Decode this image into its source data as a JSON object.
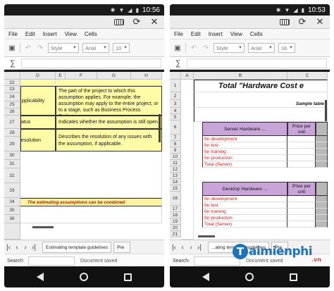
{
  "status_bar": {
    "time": "10:56",
    "time_right": "10:53"
  },
  "menu": [
    "File",
    "Edit",
    "Insert",
    "View",
    "Cells"
  ],
  "toolbar": {
    "style": "Style",
    "font": "Arial",
    "size_left": "10",
    "size_right": "16"
  },
  "formula_symbol": "∑",
  "left": {
    "columns": [
      "D",
      "E",
      "F",
      "G",
      "H"
    ],
    "rows": [
      {
        "num": "22",
        "d": "",
        "text": ""
      },
      {
        "num": "23",
        "d": "",
        "text": "The part of the project to which this assumption applies. For example, the assumption may apply to the entire project, or to a stage, such as Business Process Redesign."
      },
      {
        "num": "24",
        "d": "pplicability",
        "text": ""
      },
      {
        "num": "25",
        "d": "",
        "text": ""
      },
      {
        "num": "26",
        "d": "",
        "text": ""
      },
      {
        "num": "27",
        "d": "atus",
        "text": "Indicates whether the assumption is still open."
      },
      {
        "num": "28",
        "d": "",
        "text": ""
      },
      {
        "num": "29",
        "d": "esolution",
        "text": "Describes the resolution of any issues with the assumption, if applicable."
      },
      {
        "num": "30",
        "d": "",
        "text": ""
      },
      {
        "num": "31",
        "d": "",
        "text": ""
      },
      {
        "num": "32",
        "d": "",
        "text": ""
      },
      {
        "num": "33",
        "d": "",
        "text": ""
      },
      {
        "num": "34",
        "d": "",
        "text": "The estimating assumptions can be combined"
      },
      {
        "num": "35",
        "d": "",
        "text": ""
      },
      {
        "num": "36",
        "d": "",
        "text": ""
      }
    ],
    "top_partial": "",
    "tab_label": "Estimating template guidelines",
    "tab_next": "Pre",
    "search_label": "Search:",
    "status": "Document saved"
  },
  "right": {
    "columns": [
      "A",
      "B",
      "C"
    ],
    "title": "Total \"Hardware Cost e",
    "subtitle": "Sample table",
    "server_header": "Server Hardware ...",
    "desktop_header": "Desktop Hardware ...",
    "price_header": "Price per unit",
    "server_items": [
      "for development",
      "for test",
      "for training",
      "for production",
      "Total (Server)"
    ],
    "desktop_items": [
      "for development",
      "for test",
      "for training",
      "for production",
      "Total (Server)"
    ],
    "row_numbers": [
      "1",
      "2",
      "3",
      "4",
      "5",
      "6",
      "7",
      "8",
      "9",
      "10",
      "11",
      "12",
      "13",
      "14",
      "15",
      "16",
      "17",
      "18",
      "19",
      "20",
      "21"
    ],
    "tab_label": "...ating template guidelines",
    "tab_next": "Pre",
    "search_label": "Search:",
    "status": "Document saved"
  },
  "watermark": {
    "letter": "T",
    "name": "aimienphi",
    "suffix": ".vn"
  }
}
